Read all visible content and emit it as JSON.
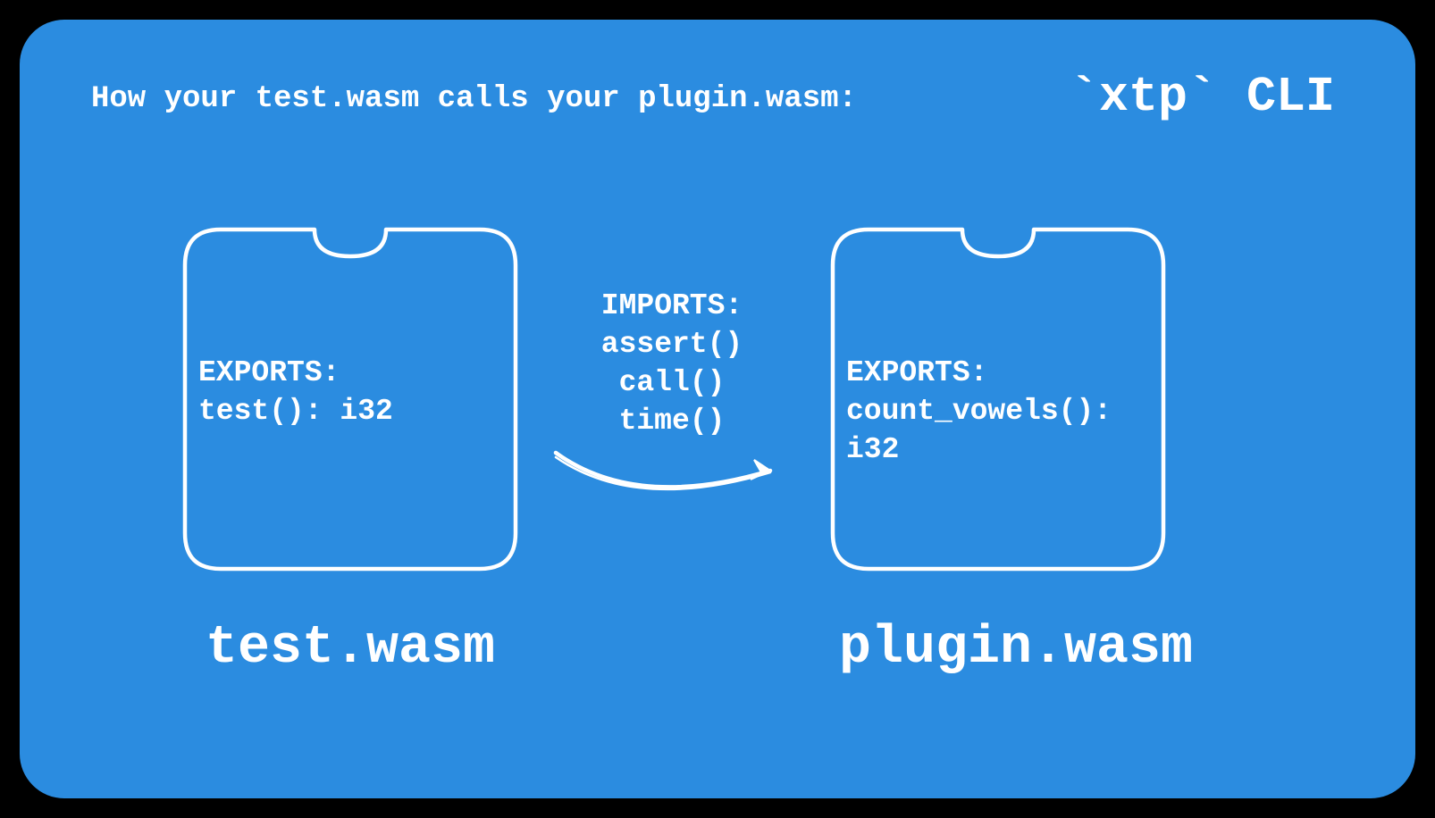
{
  "header": "How your test.wasm calls your plugin.wasm:",
  "cli_label": "`xtp` CLI",
  "left_module": {
    "exports_label": "EXPORTS:",
    "exports_fn": "test(): i32",
    "name": "test.wasm"
  },
  "right_module": {
    "exports_label": "EXPORTS:",
    "exports_fn": "count_vowels(): i32",
    "name": "plugin.wasm"
  },
  "imports": {
    "label": "IMPORTS:",
    "fn1": "assert()",
    "fn2": "call()",
    "fn3": "time()"
  }
}
